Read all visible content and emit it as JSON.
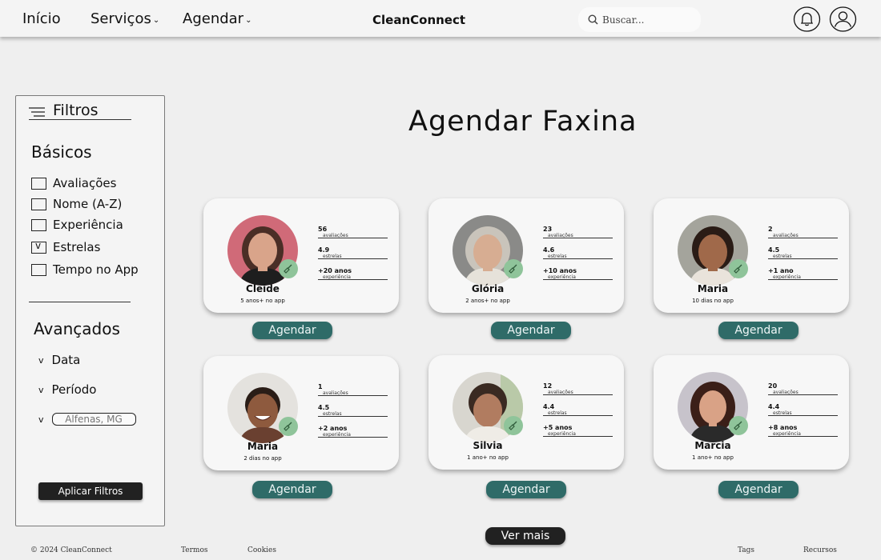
{
  "nav": {
    "home": "Início",
    "services": "Serviços",
    "schedule": "Agendar",
    "brand": "CleanConnect",
    "search_placeholder": "Buscar..."
  },
  "sidebar": {
    "title": "Filtros",
    "basic_title": "Básicos",
    "basic_items": [
      {
        "label": "Avaliações",
        "checked": false
      },
      {
        "label": "Nome (A-Z)",
        "checked": false
      },
      {
        "label": "Experiência",
        "checked": false
      },
      {
        "label": "Estrelas",
        "checked": true
      },
      {
        "label": "Tempo no App",
        "checked": false
      }
    ],
    "advanced_title": "Avançados",
    "advanced_items": [
      "Data",
      "Período"
    ],
    "city_placeholder": "Alfenas, MG",
    "apply_label": "Aplicar Filtros"
  },
  "main": {
    "title": "Agendar Faxina",
    "book_label": "Agendar",
    "more_label": "Ver mais"
  },
  "cards": [
    {
      "name": "Cleide",
      "since": "5 anos+ no app",
      "reviews": "56",
      "reviews_label": "avaliações",
      "stars": "4.9",
      "stars_label": "estrelas",
      "exp": "+20 anos",
      "exp_label": "experiência"
    },
    {
      "name": "Glória",
      "since": "2 anos+ no app",
      "reviews": "23",
      "reviews_label": "avaliações",
      "stars": "4.6",
      "stars_label": "estrelas",
      "exp": "+10 anos",
      "exp_label": "experiência"
    },
    {
      "name": "Maria",
      "since": "10 dias no app",
      "reviews": "2",
      "reviews_label": "avaliações",
      "stars": "4.5",
      "stars_label": "estrelas",
      "exp": "+1 ano",
      "exp_label": "experiência"
    },
    {
      "name": "Maria",
      "since": "2 dias no app",
      "reviews": "1",
      "reviews_label": "avaliações",
      "stars": "4.5",
      "stars_label": "estrelas",
      "exp": "+2 anos",
      "exp_label": "experiência"
    },
    {
      "name": "Silvia",
      "since": "1 ano+ no app",
      "reviews": "12",
      "reviews_label": "avaliações",
      "stars": "4.4",
      "stars_label": "estrelas",
      "exp": "+5 anos",
      "exp_label": "experiência"
    },
    {
      "name": "Marcia",
      "since": "1 ano+ no app",
      "reviews": "20",
      "reviews_label": "avaliações",
      "stars": "4.4",
      "stars_label": "estrelas",
      "exp": "+8 anos",
      "exp_label": "experiência"
    }
  ],
  "footer": {
    "copyright": "© 2024 CleanConnect",
    "terms": "Termos",
    "cookies": "Cookies",
    "tags": "Tags",
    "resources": "Recursos"
  },
  "colors": {
    "accent": "#2f6b68",
    "badge": "#8fc49a",
    "dark_button": "#212121"
  }
}
